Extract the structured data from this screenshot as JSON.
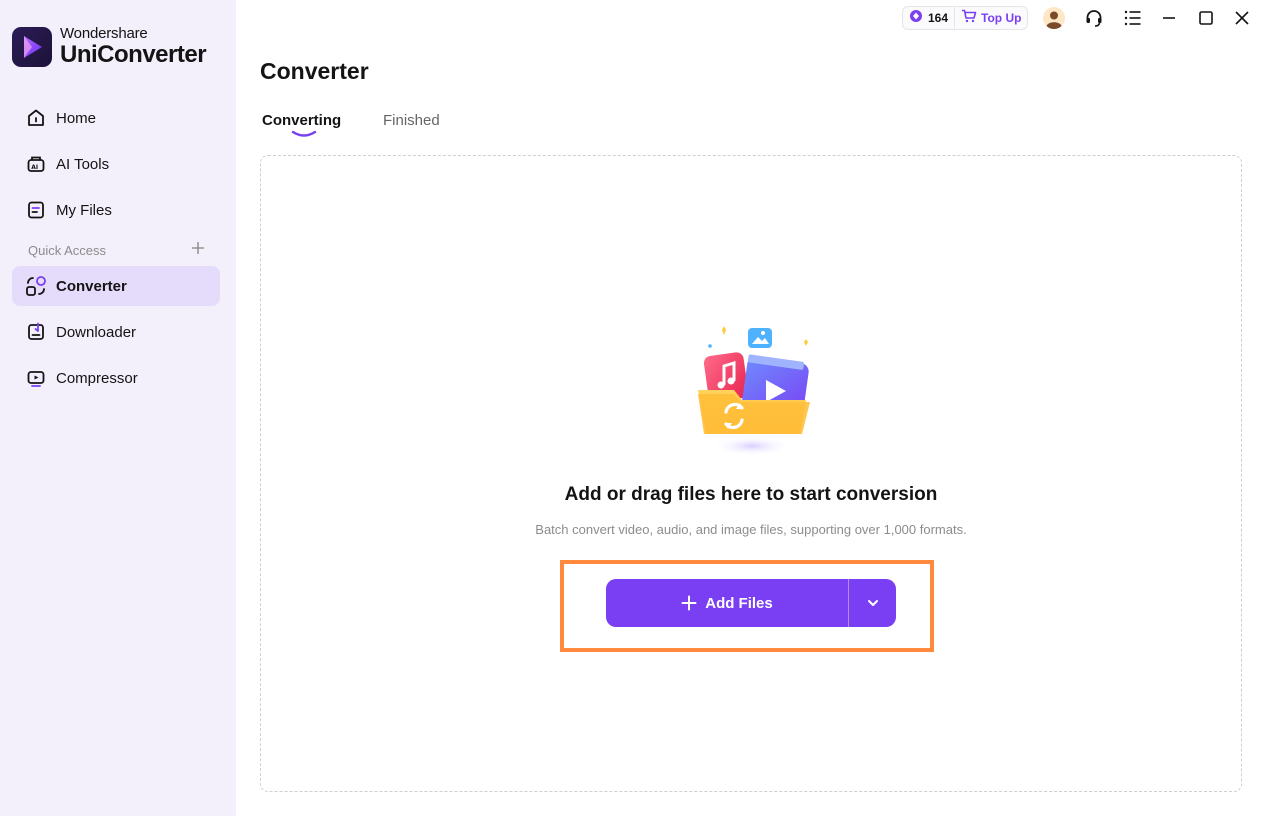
{
  "brand": {
    "company": "Wondershare",
    "product": "UniConverter"
  },
  "sidebar": {
    "items": [
      {
        "label": "Home",
        "icon": "home-icon"
      },
      {
        "label": "AI Tools",
        "icon": "ai-tools-icon"
      },
      {
        "label": "My Files",
        "icon": "my-files-icon"
      }
    ],
    "quick_access_label": "Quick Access",
    "quick_items": [
      {
        "label": "Converter",
        "icon": "converter-icon",
        "active": true
      },
      {
        "label": "Downloader",
        "icon": "downloader-icon"
      },
      {
        "label": "Compressor",
        "icon": "compressor-icon"
      }
    ]
  },
  "topbar": {
    "credits": "164",
    "top_up_label": "Top Up",
    "icons": [
      "avatar",
      "headset-icon",
      "menu-icon",
      "minimize-icon",
      "maximize-icon",
      "close-icon"
    ]
  },
  "main": {
    "title": "Converter",
    "tabs": [
      {
        "label": "Converting",
        "active": true
      },
      {
        "label": "Finished",
        "active": false
      }
    ],
    "drop_title": "Add or drag files here to start conversion",
    "drop_subtitle": "Batch convert video, audio, and image files, supporting over 1,000 formats.",
    "add_files_label": "Add Files"
  },
  "colors": {
    "accent": "#7a3ff2",
    "highlight": "#ff8a3d",
    "sidebar_bg": "#f3effb",
    "active_bg": "#e5dbfb"
  }
}
